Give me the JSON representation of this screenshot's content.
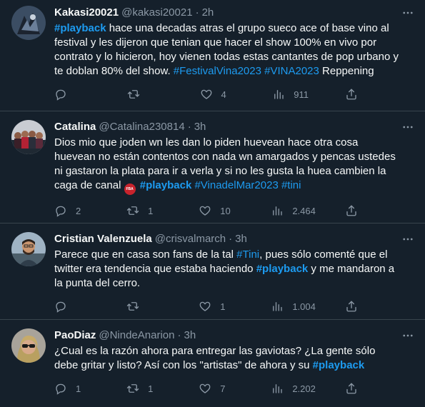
{
  "tweets": [
    {
      "name": "Kakasi20021",
      "handle": "@kakasi20021",
      "time": "2h",
      "text_parts": [
        {
          "t": "#playback",
          "c": "hl bold"
        },
        {
          "t": " hace una decadas atras el grupo sueco ace of base vino al festival y les dijeron que tenian que hacer el show 100% en vivo por contrato y lo hicieron, hoy vienen todas estas cantantes de pop urbano y te doblan 80% del show. "
        },
        {
          "t": "#FestivalVina2023",
          "c": "hl"
        },
        {
          "t": "  "
        },
        {
          "t": "#VINA2023",
          "c": "hl"
        },
        {
          "t": "  Reppening"
        }
      ],
      "replies": "",
      "retweets": "",
      "likes": "4",
      "views": "911"
    },
    {
      "name": "Catalina",
      "handle": "@Catalina230814",
      "time": "3h",
      "text_parts": [
        {
          "t": "Dios mio que joden wn les dan lo piden huevean hace otra cosa huevean no están contentos con nada wn amargados y pencas ustedes ni gastaron la plata para ir a verla y si no les gusta la huea cambien la caga de canal "
        },
        {
          "t": "EMOJI",
          "c": "emoji"
        },
        {
          "t": " "
        },
        {
          "t": "#playback",
          "c": "hl bold"
        },
        {
          "t": " "
        },
        {
          "t": "#VinadelMar2023",
          "c": "hl"
        },
        {
          "t": " "
        },
        {
          "t": "#tini",
          "c": "hl"
        }
      ],
      "emoji_text": "FBA",
      "replies": "2",
      "retweets": "1",
      "likes": "10",
      "views": "2.464"
    },
    {
      "name": "Cristian Valenzuela",
      "handle": "@crisvalmarch",
      "time": "3h",
      "text_parts": [
        {
          "t": "Parece que en casa son fans de la tal "
        },
        {
          "t": "#Tini",
          "c": "hl"
        },
        {
          "t": ", pues sólo comenté que el twitter era tendencia que estaba haciendo "
        },
        {
          "t": "#playback",
          "c": "hl bold"
        },
        {
          "t": " y me mandaron a la punta del cerro."
        }
      ],
      "replies": "",
      "retweets": "",
      "likes": "1",
      "views": "1.004"
    },
    {
      "name": "PaoDiaz",
      "handle": "@NindeAnarion",
      "time": "3h",
      "text_parts": [
        {
          "t": "¿Cual es la razón ahora para entregar las gaviotas? ¿La gente sólo debe gritar y listo? Así con los \"artistas\" de ahora y su "
        },
        {
          "t": "#playback",
          "c": "hl bold"
        }
      ],
      "replies": "1",
      "retweets": "1",
      "likes": "7",
      "views": "2.202"
    }
  ],
  "colors": {
    "background": "#15202b",
    "text": "#f7f9f9",
    "muted": "#8b98a5",
    "link": "#1d9bf0",
    "divider": "#38444d"
  },
  "icons": [
    "reply-icon",
    "retweet-icon",
    "like-icon",
    "views-icon",
    "share-icon",
    "more-icon"
  ]
}
